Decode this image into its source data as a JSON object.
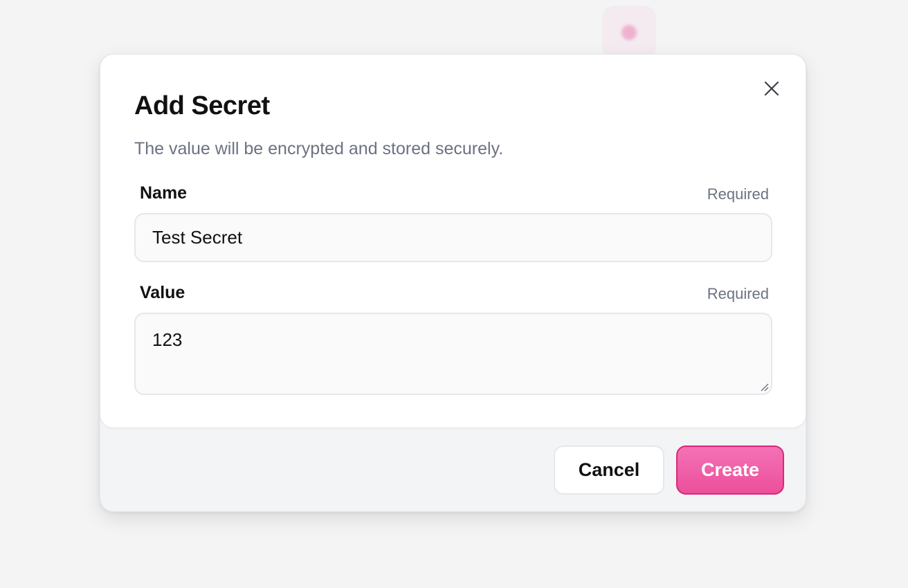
{
  "modal": {
    "title": "Add Secret",
    "subtitle": "The value will be encrypted and stored securely.",
    "close_icon": "close-icon"
  },
  "fields": {
    "name": {
      "label": "Name",
      "required_text": "Required",
      "value": "Test Secret"
    },
    "value": {
      "label": "Value",
      "required_text": "Required",
      "value": "123"
    }
  },
  "footer": {
    "cancel_label": "Cancel",
    "create_label": "Create"
  },
  "colors": {
    "accent": "#ec4899",
    "accent_border": "#db2777",
    "muted_text": "#6b7280",
    "footer_bg": "#f3f4f6"
  }
}
